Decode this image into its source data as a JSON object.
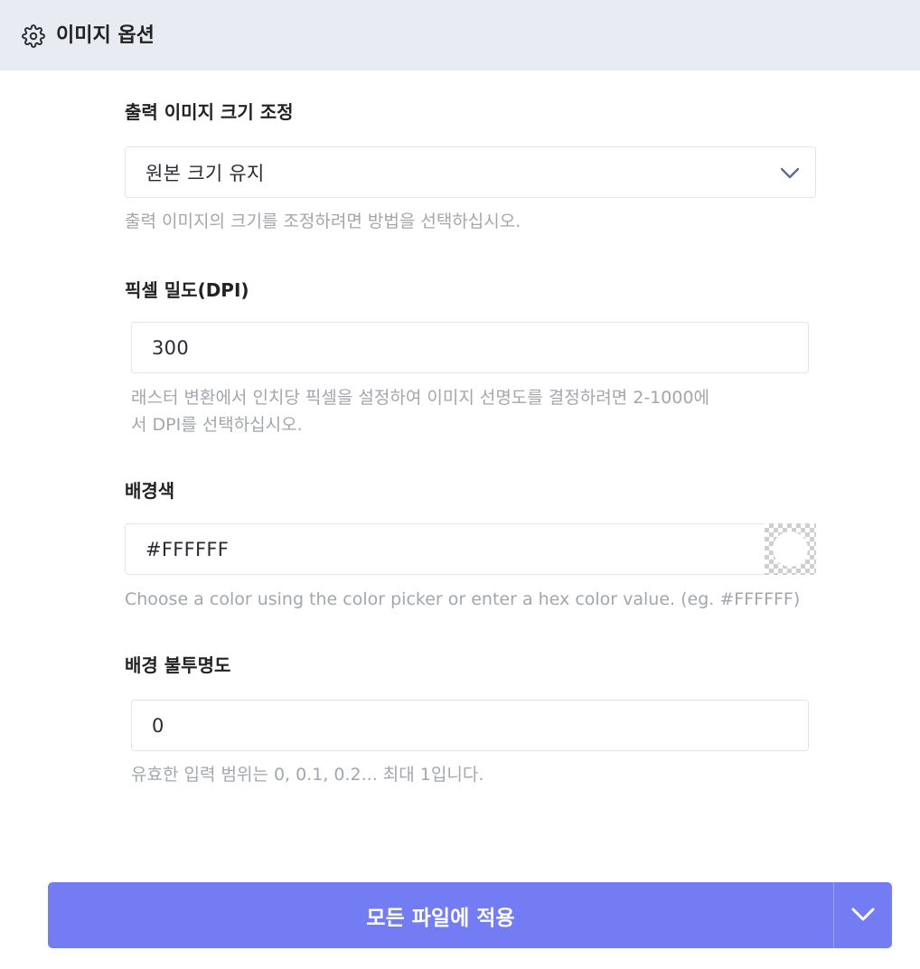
{
  "header": {
    "title": "이미지 옵션",
    "icon": "gear-icon"
  },
  "resize": {
    "label": "출력 이미지 크기 조정",
    "selected": "원본 크기 유지",
    "help": "출력 이미지의 크기를 조정하려면 방법을 선택하십시오."
  },
  "dpi": {
    "label": "픽셀 밀도(DPI)",
    "value": "300",
    "help_line1": "래스터 변환에서 인치당 픽셀을 설정하여 이미지 선명도를 결정하려면 2-1000에",
    "help_line2": "서 DPI를 선택하십시오."
  },
  "background": {
    "label": "배경색",
    "value": "#FFFFFF",
    "help": "Choose a color using the color picker or enter a hex color value. (eg. #FFFFFF)"
  },
  "opacity": {
    "label": "배경 불투명도",
    "value": "0",
    "help": "유효한 입력 범위는 0, 0.1, 0.2... 최대 1입니다."
  },
  "apply_button": {
    "label": "모든 파일에 적용"
  },
  "colors": {
    "header_bg": "#e8ebf2",
    "accent": "#737cf3",
    "chevron": "#5a6d8c",
    "help_text": "#a3a6ad"
  }
}
